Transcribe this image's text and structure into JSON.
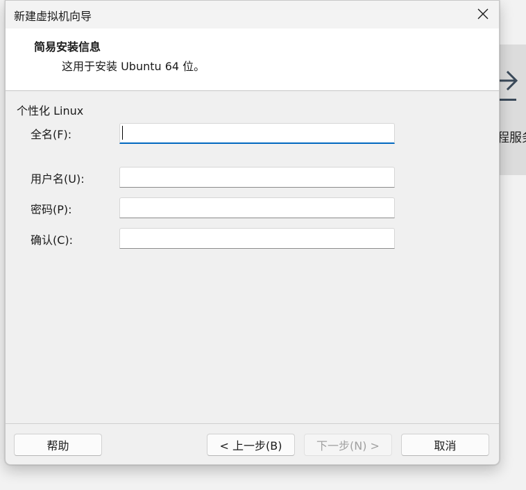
{
  "background": {
    "partial_text": "程服务",
    "arrow_icon": "arrow-right-icon"
  },
  "dialog": {
    "title": "新建虚拟机向导",
    "close_icon": "close-icon",
    "header": {
      "title": "简易安装信息",
      "subtitle": "这用于安装 Ubuntu 64 位。"
    },
    "group_label": "个性化 Linux",
    "fields": {
      "fullname": {
        "label": "全名(F):",
        "value": "",
        "placeholder": ""
      },
      "username": {
        "label": "用户名(U):",
        "value": "",
        "placeholder": ""
      },
      "password": {
        "label": "密码(P):",
        "value": "",
        "placeholder": ""
      },
      "confirm": {
        "label": "确认(C):",
        "value": "",
        "placeholder": ""
      }
    },
    "buttons": {
      "help": "帮助",
      "back": "< 上一步(B)",
      "next": "下一步(N) >",
      "cancel": "取消"
    }
  }
}
